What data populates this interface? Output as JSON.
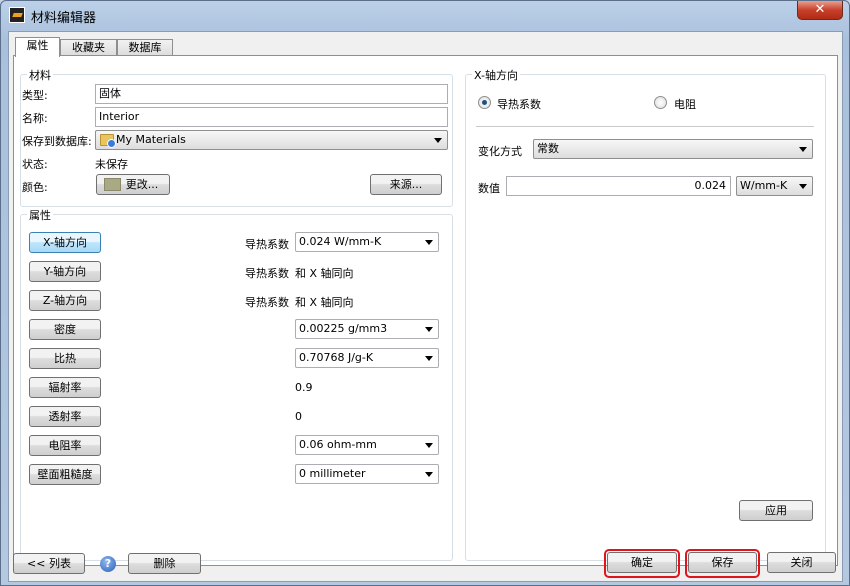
{
  "window": {
    "title": "材料编辑器",
    "close_glyph": "✕"
  },
  "tabs": [
    "属性",
    "收藏夹",
    "数据库"
  ],
  "material": {
    "group_title": "材料",
    "type_label": "类型:",
    "type_value": "固体",
    "name_label": "名称:",
    "name_value": "Interior",
    "save_to_label": "保存到数据库:",
    "save_to_value": "My Materials",
    "status_label": "状态:",
    "status_value": "未保存",
    "color_label": "颜色:",
    "change_btn": "更改...",
    "source_btn": "来源..."
  },
  "properties": {
    "group_title": "属性",
    "rows": [
      {
        "button": "X-轴方向",
        "label": "导热系数",
        "value": "0.024 W/mm-K",
        "kind": "combo"
      },
      {
        "button": "Y-轴方向",
        "label": "导热系数",
        "value": "和 X 轴同向",
        "kind": "text"
      },
      {
        "button": "Z-轴方向",
        "label": "导热系数",
        "value": "和 X 轴同向",
        "kind": "text"
      },
      {
        "button": "密度",
        "label": "",
        "value": "0.00225 g/mm3",
        "kind": "combo"
      },
      {
        "button": "比热",
        "label": "",
        "value": "0.70768 J/g-K",
        "kind": "combo"
      },
      {
        "button": "辐射率",
        "label": "",
        "value": "0.9",
        "kind": "text"
      },
      {
        "button": "透射率",
        "label": "",
        "value": "0",
        "kind": "text"
      },
      {
        "button": "电阻率",
        "label": "",
        "value": "0.06 ohm-mm",
        "kind": "combo"
      },
      {
        "button": "壁面粗糙度",
        "label": "",
        "value": "0 millimeter",
        "kind": "combo"
      }
    ]
  },
  "xaxis": {
    "group_title": "X-轴方向",
    "radio_conductivity": "导热系数",
    "radio_resistance": "电阻",
    "variation_label": "变化方式",
    "variation_value": "常数",
    "value_label": "数值",
    "value": "0.024",
    "unit": "W/mm-K",
    "apply_btn": "应用"
  },
  "footer": {
    "list_btn": "<< 列表",
    "help_glyph": "?",
    "delete_btn": "删除",
    "ok_btn": "确定",
    "save_btn": "保存",
    "close_btn": "关闭"
  }
}
